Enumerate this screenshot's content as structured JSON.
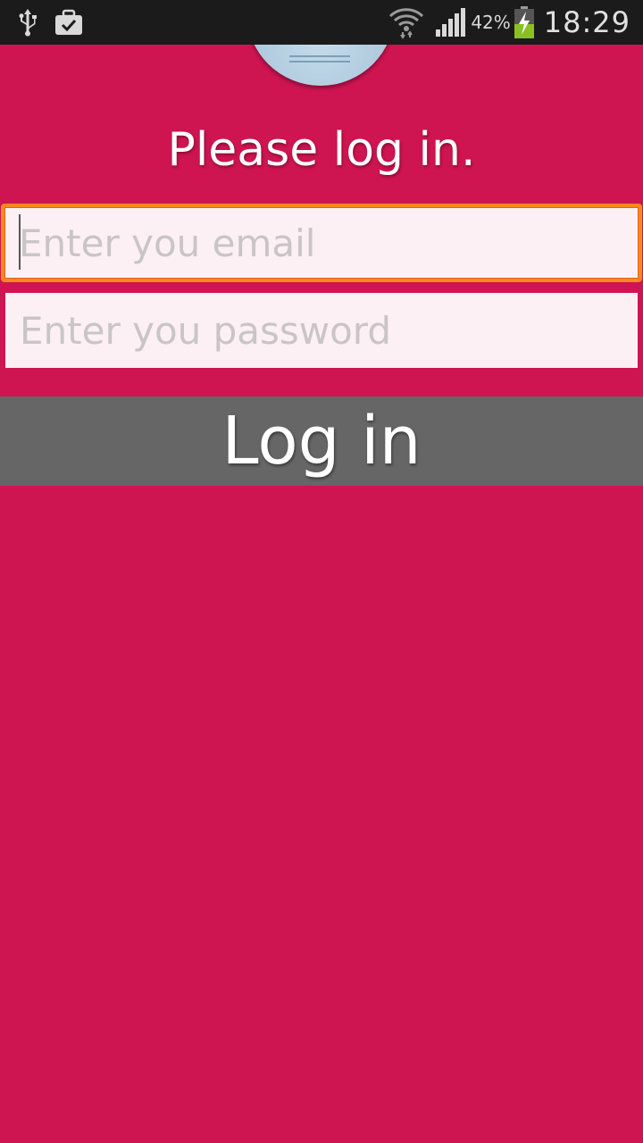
{
  "status_bar": {
    "battery_percent": "42%",
    "time": "18:29",
    "left_icons": [
      "usb-icon",
      "briefcase-check-icon"
    ],
    "right_icons": [
      "wifi-icon",
      "signal-icon",
      "battery-charging-icon"
    ]
  },
  "login": {
    "title": "Please log in.",
    "email_placeholder": "Enter you email",
    "email_value": "",
    "password_placeholder": "Enter you password",
    "password_value": "",
    "button_label": "Log in"
  },
  "colors": {
    "background": "#cf1452",
    "button": "#666666",
    "field_focus": "#f58a1f",
    "status_bar": "#1b1b1b"
  }
}
